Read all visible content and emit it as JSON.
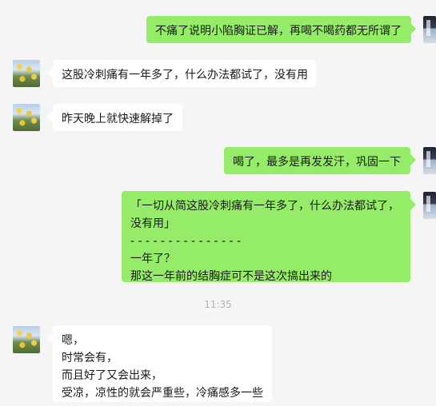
{
  "messages": [
    {
      "side": "right",
      "lines": [
        "不痛了说明小陷胸证已解，再喝不喝药都无所谓了"
      ]
    },
    {
      "side": "left",
      "lines": [
        "这股冷刺痛有一年多了，什么办法都试了，没有用"
      ]
    },
    {
      "side": "left",
      "lines": [
        "昨天晚上就快速解掉了"
      ]
    },
    {
      "side": "right",
      "lines": [
        "喝了，最多是再发发汗，巩固一下"
      ]
    },
    {
      "side": "right",
      "lines": [
        "「一切从简这股冷刺痛有一年多了，什么办法都试了，",
        "没有用」",
        "- - - - - - - - - - - - - - -",
        "一年了？",
        "那这一年前的结胸症可不是这次搞出来的"
      ]
    },
    {
      "side": "left",
      "lines": [
        "嗯，",
        "时常会有，",
        "而且好了又会出来，",
        "受凉，凉性的就会严重些，冷痛感多一些"
      ]
    }
  ],
  "timestamp": "11:35",
  "colors": {
    "outgoing_bubble": "#95ec69",
    "incoming_bubble": "#ffffff",
    "background": "#f5f5f5"
  }
}
